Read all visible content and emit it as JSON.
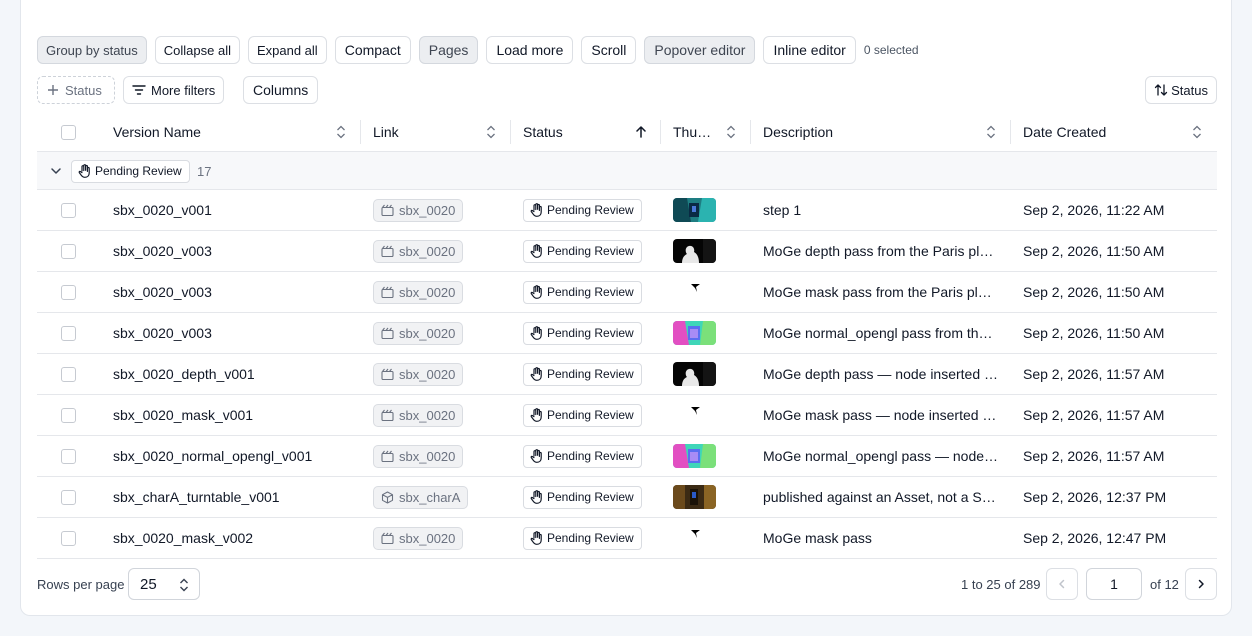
{
  "toolbar": {
    "buttons": [
      {
        "label": "Group by status",
        "active": true
      },
      {
        "label": "Collapse all",
        "active": false
      },
      {
        "label": "Expand all",
        "active": false
      },
      {
        "label": "Compact",
        "active": false
      },
      {
        "label": "Pages",
        "active": true
      },
      {
        "label": "Load more",
        "active": false
      },
      {
        "label": "Scroll",
        "active": false
      },
      {
        "label": "Popover editor",
        "active": true
      },
      {
        "label": "Inline editor",
        "active": false
      }
    ],
    "selected_text": "0 selected"
  },
  "filters": {
    "status_label": "Status",
    "more_filters_label": "More filters",
    "columns_label": "Columns",
    "sort_label": "Status"
  },
  "table": {
    "headers": {
      "version_name": "Version Name",
      "link": "Link",
      "status": "Status",
      "thumbnail": "Thu…",
      "description": "Description",
      "date_created": "Date Created"
    },
    "group": {
      "label": "Pending Review",
      "count": "17"
    },
    "rows": [
      {
        "name": "sbx_0020_v001",
        "link": "sbx_0020",
        "link_type": "shot",
        "status": "Pending Review",
        "thumb": "teal",
        "description": "step 1",
        "date": "Sep 2, 2026, 11:22 AM"
      },
      {
        "name": "sbx_0020_v003",
        "link": "sbx_0020",
        "link_type": "shot",
        "status": "Pending Review",
        "thumb": "depth",
        "description": "MoGe depth pass from the Paris pl…",
        "date": "Sep 2, 2026, 11:50 AM"
      },
      {
        "name": "sbx_0020_v003",
        "link": "sbx_0020",
        "link_type": "shot",
        "status": "Pending Review",
        "thumb": "mask",
        "description": "MoGe mask pass from the Paris pla…",
        "date": "Sep 2, 2026, 11:50 AM"
      },
      {
        "name": "sbx_0020_v003",
        "link": "sbx_0020",
        "link_type": "shot",
        "status": "Pending Review",
        "thumb": "normal",
        "description": "MoGe normal_opengl pass from th…",
        "date": "Sep 2, 2026, 11:50 AM"
      },
      {
        "name": "sbx_0020_depth_v001",
        "link": "sbx_0020",
        "link_type": "shot",
        "status": "Pending Review",
        "thumb": "depth",
        "description": "MoGe depth pass — node inserted …",
        "date": "Sep 2, 2026, 11:57 AM"
      },
      {
        "name": "sbx_0020_mask_v001",
        "link": "sbx_0020",
        "link_type": "shot",
        "status": "Pending Review",
        "thumb": "mask",
        "description": "MoGe mask pass — node inserted …",
        "date": "Sep 2, 2026, 11:57 AM"
      },
      {
        "name": "sbx_0020_normal_opengl_v001",
        "link": "sbx_0020",
        "link_type": "shot",
        "status": "Pending Review",
        "thumb": "normal",
        "description": "MoGe normal_opengl pass — node …",
        "date": "Sep 2, 2026, 11:57 AM"
      },
      {
        "name": "sbx_charA_turntable_v001",
        "link": "sbx_charA",
        "link_type": "asset",
        "status": "Pending Review",
        "thumb": "brown",
        "description": "published against an Asset, not a S…",
        "date": "Sep 2, 2026, 12:37 PM"
      },
      {
        "name": "sbx_0020_mask_v002",
        "link": "sbx_0020",
        "link_type": "shot",
        "status": "Pending Review",
        "thumb": "mask",
        "description": "MoGe mask pass",
        "date": "Sep 2, 2026, 12:47 PM"
      }
    ]
  },
  "footer": {
    "rows_per_page_label": "Rows per page",
    "rows_per_page_value": "25",
    "range_text": "1 to 25 of 289",
    "page_value": "1",
    "of_pages_text": "of 12"
  }
}
